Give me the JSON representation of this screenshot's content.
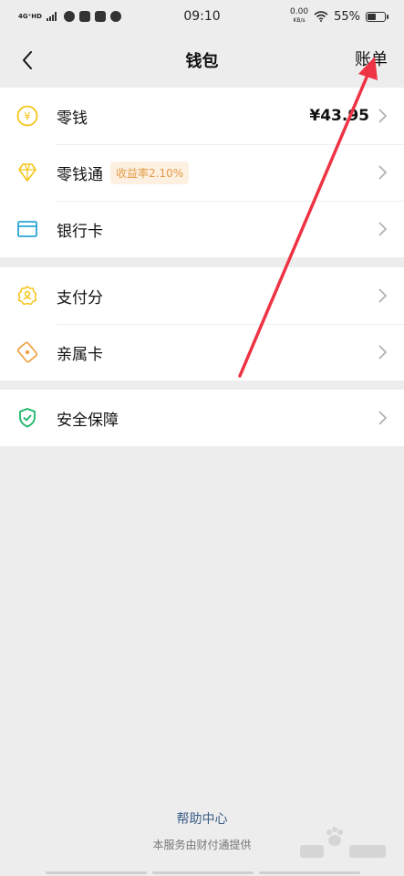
{
  "status_bar": {
    "network": "4G⁺HD",
    "time": "09:10",
    "speed_value": "0.00",
    "speed_unit": "KB/s",
    "battery": "55%",
    "battery_level": 0.55
  },
  "nav": {
    "title": "钱包",
    "bill_label": "账单"
  },
  "groups": [
    {
      "items": [
        {
          "label": "零钱",
          "value": "¥43.95",
          "icon": "yen-coin-icon",
          "color": "#f5c518"
        },
        {
          "label": "零钱通",
          "badge": "收益率2.10%",
          "icon": "diamond-icon",
          "color": "#f5c518"
        },
        {
          "label": "银行卡",
          "icon": "bank-card-icon",
          "color": "#2aa6d4"
        }
      ]
    },
    {
      "items": [
        {
          "label": "支付分",
          "icon": "pay-score-icon",
          "color": "#f5c518"
        },
        {
          "label": "亲属卡",
          "icon": "family-card-icon",
          "color": "#f0a040"
        }
      ]
    },
    {
      "items": [
        {
          "label": "安全保障",
          "icon": "shield-check-icon",
          "color": "#18b566"
        }
      ]
    }
  ],
  "footer": {
    "help_center": "帮助中心",
    "provider_note": "本服务由财付通提供"
  },
  "colors": {
    "background": "#ededed",
    "link": "#3c5d87",
    "annotation_arrow": "#ee3344"
  }
}
